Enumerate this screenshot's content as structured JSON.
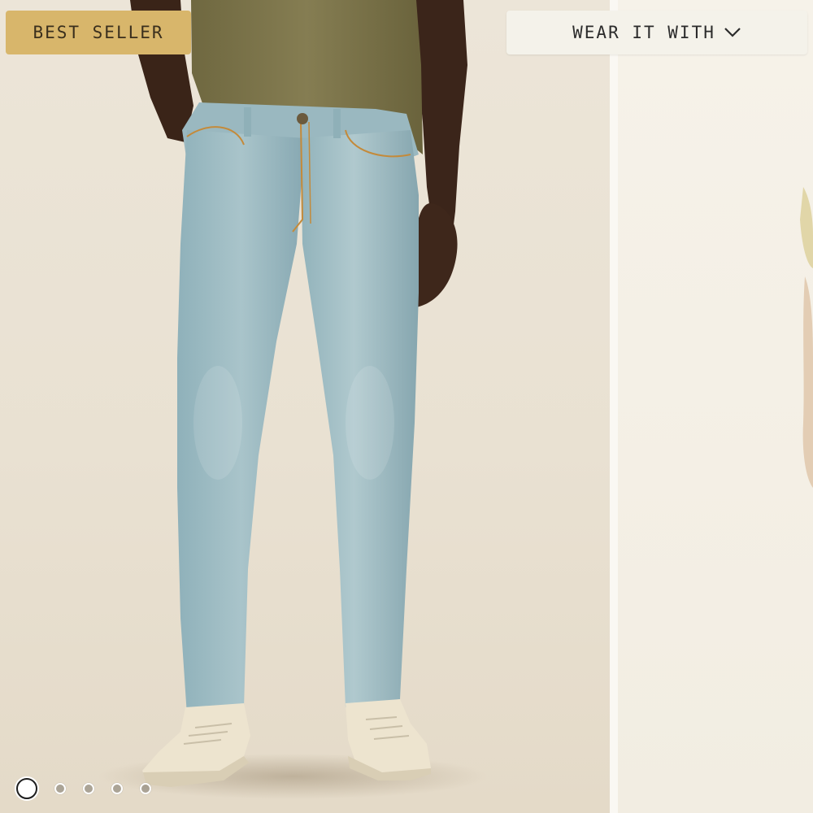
{
  "badge": {
    "label": "BEST SELLER"
  },
  "wear_it_with": {
    "label": "WEAR IT WITH",
    "icon": "chevron-down-icon"
  },
  "carousel": {
    "total_slides": 5,
    "active_index": 0
  },
  "colors": {
    "badge_bg": "#d8b66b",
    "button_bg": "#f4f2ea",
    "denim": "#9cbac2",
    "shirt": "#7a7248",
    "background": "#ece5d8"
  }
}
